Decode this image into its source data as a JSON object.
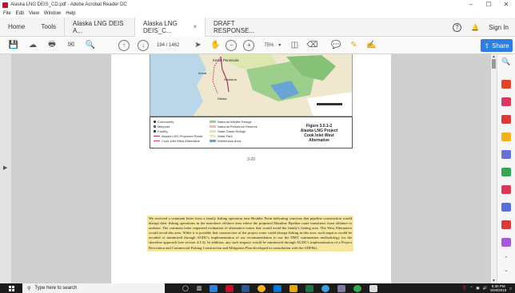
{
  "window": {
    "title": "Alaska LNG DEIS_CD.pdf - Adobe Acrobat Reader DC",
    "controls": [
      "–",
      "☐",
      "✕"
    ]
  },
  "menubar": [
    "File",
    "Edit",
    "View",
    "Window",
    "Help"
  ],
  "tabs": {
    "home": "Home",
    "tools": "Tools",
    "docs": [
      {
        "label": "Alaska LNG DEIS A...",
        "active": false,
        "closable": false
      },
      {
        "label": "Alaska LNG DEIS_C...",
        "active": true,
        "closable": true
      },
      {
        "label": "DRAFT RESPONSE...",
        "active": false,
        "closable": false
      }
    ],
    "sign_in": "Sign In"
  },
  "toolbar": {
    "current_page": "194",
    "page_sep": "/",
    "total_pages": "1462",
    "zoom": "75%",
    "share_label": "Share"
  },
  "map": {
    "labels": [
      "Kenai Peninsula",
      "Kenai",
      "Soldotna",
      "Nikiski"
    ],
    "legend_left": [
      "Community",
      "Milepost",
      "Facility",
      "Alaska LNG Proposed Route",
      "Cook Inlet West Alternative"
    ],
    "legend_mid": [
      "National Wildlife Refuge",
      "National Petroleum Reserve",
      "State Game Refuge",
      "State Park",
      "Wilderness Area"
    ],
    "figure_title": [
      "Figure 3.5.1-2",
      "Alaska LNG Project",
      "Cook Inlet West",
      "Alternative"
    ],
    "page_number": "3-20"
  },
  "page2": {
    "paragraph": "We received a comment letter from a family fishing operation near Boulder Point indicating concerns that pipeline construction would disrupt their fishing operations in the nearshore offshore area where the proposed Mainline Pipeline route transitions from offshore to onshore. The comment letter requested evaluation of alternative routes that would avoid the family's fishing area. The West Alternative would avoid this area. While it is possible that construction of the project route could disrupt fishing in this area, such impacts would be avoided or minimized through AGDC's implementation of our recommendation to use the DMT continuation methodology for the shoreline approach (see section 4.3.3). In addition, any such impacts would be minimized through AGDC's implementation of a Project Recreation and Commercial Fishing Construction and Mitigation Plan developed in consultation with the ADF&G."
  },
  "taskbar": {
    "search_placeholder": "Type here to search",
    "time": "5:30 PM",
    "date": "8/29/2019"
  },
  "colors": {
    "accent": "#2d7fde",
    "highlight": "#f5e6a0",
    "taskbar": "#1b1b1b"
  }
}
